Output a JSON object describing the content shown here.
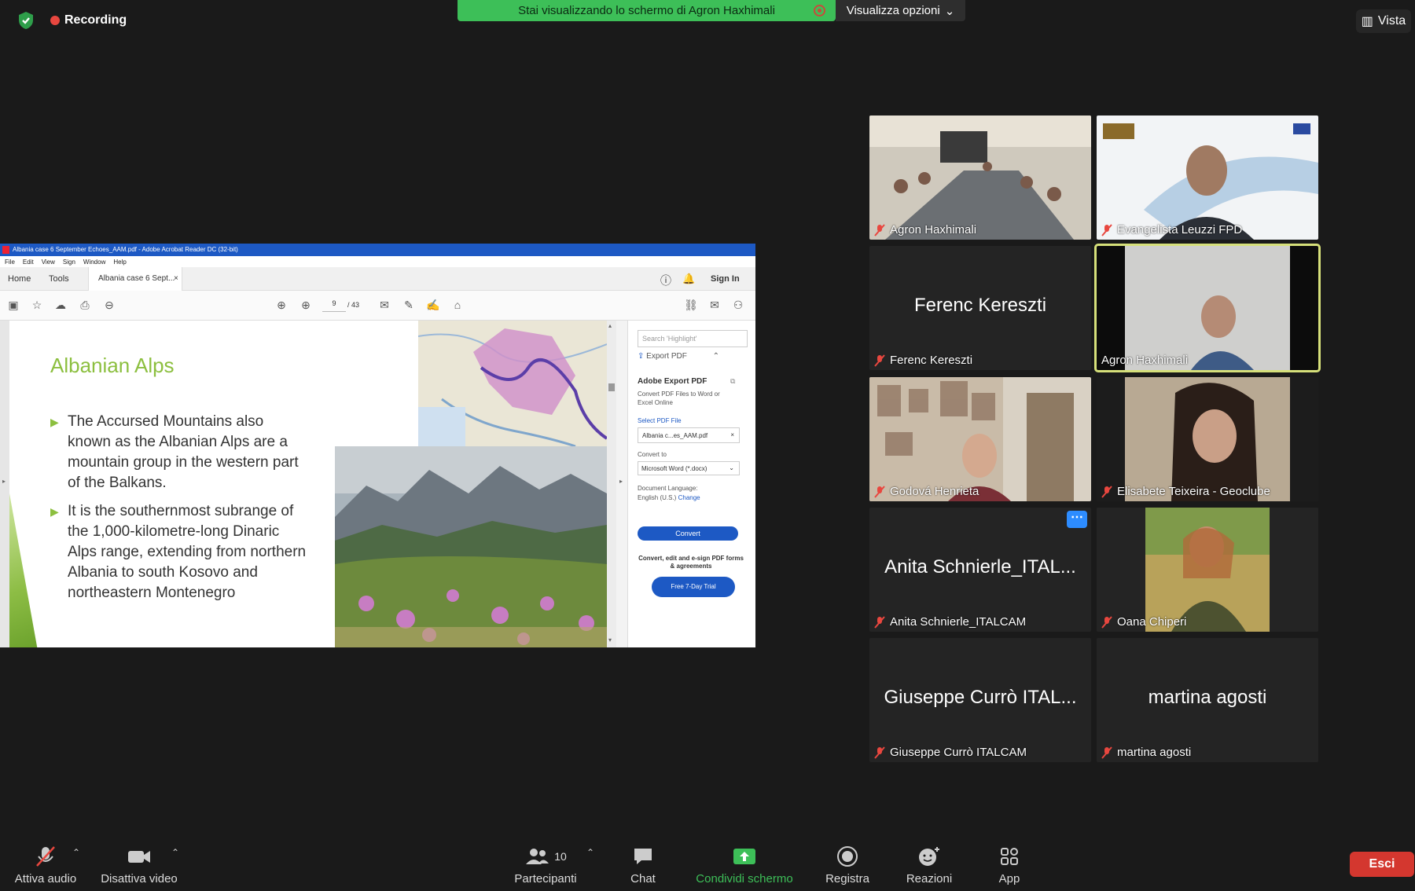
{
  "top": {
    "recording_label": "Recording",
    "share_banner": "Stai visualizzando lo schermo di Agron Haxhimali",
    "view_options": "Visualizza opzioni",
    "vista": "Vista"
  },
  "acrobat": {
    "title": "Albania case 6 September Echoes_AAM.pdf - Adobe Acrobat Reader DC (32-bit)",
    "menu": [
      "File",
      "Edit",
      "View",
      "Sign",
      "Window",
      "Help"
    ],
    "tabs": {
      "home": "Home",
      "tools": "Tools",
      "doc": "Albania case 6 Sept..."
    },
    "sign_in": "Sign In",
    "page_current": "9",
    "page_total": "/ 43",
    "slide": {
      "title": "Albanian Alps",
      "bullet1": "The Accursed Mountains also known as the Albanian Alps are a mountain group in the western part of the Balkans.",
      "bullet2": "It is the southernmost subrange of the 1,000-kilometre-long Dinaric Alps range, extending from northern Albania to south Kosovo and northeastern Montenegro"
    },
    "export": {
      "search_placeholder": "Search 'Highlight'",
      "header": "Export PDF",
      "title": "Adobe Export PDF",
      "desc": "Convert PDF Files to Word or Excel Online",
      "select_label": "Select PDF File",
      "file": "Albania c...es_AAM.pdf",
      "convert_to": "Convert to",
      "format": "Microsoft Word (*.docx)",
      "lang_label": "Document Language:",
      "lang_value": "English (U.S.)",
      "change": "Change",
      "convert_btn": "Convert",
      "promo": "Convert, edit and e-sign PDF forms & agreements",
      "trial": "Free 7-Day Trial"
    }
  },
  "participants": [
    {
      "name": "Agron Haxhimali",
      "big": ""
    },
    {
      "name": "Evangelista Leuzzi FPD",
      "big": ""
    },
    {
      "name": "Ferenc Kereszti",
      "big": "Ferenc Kereszti"
    },
    {
      "name": "Agron Haxhimali",
      "big": ""
    },
    {
      "name": "Godová Henrieta",
      "big": ""
    },
    {
      "name": "Elisabete Teixeira - Geoclube",
      "big": ""
    },
    {
      "name": "Anita Schnierle_ITALCAM",
      "big": "Anita Schnierle_ITAL..."
    },
    {
      "name": "Oana Chiperi",
      "big": ""
    },
    {
      "name": "Giuseppe Currò ITALCAM",
      "big": "Giuseppe Currò ITAL..."
    },
    {
      "name": "martina agosti",
      "big": "martina agosti"
    }
  ],
  "toolbar": {
    "audio": "Attiva audio",
    "video": "Disattiva video",
    "participants": "Partecipanti",
    "participants_count": "10",
    "chat": "Chat",
    "share": "Condividi schermo",
    "record": "Registra",
    "reactions": "Reazioni",
    "apps": "App",
    "leave": "Esci"
  }
}
